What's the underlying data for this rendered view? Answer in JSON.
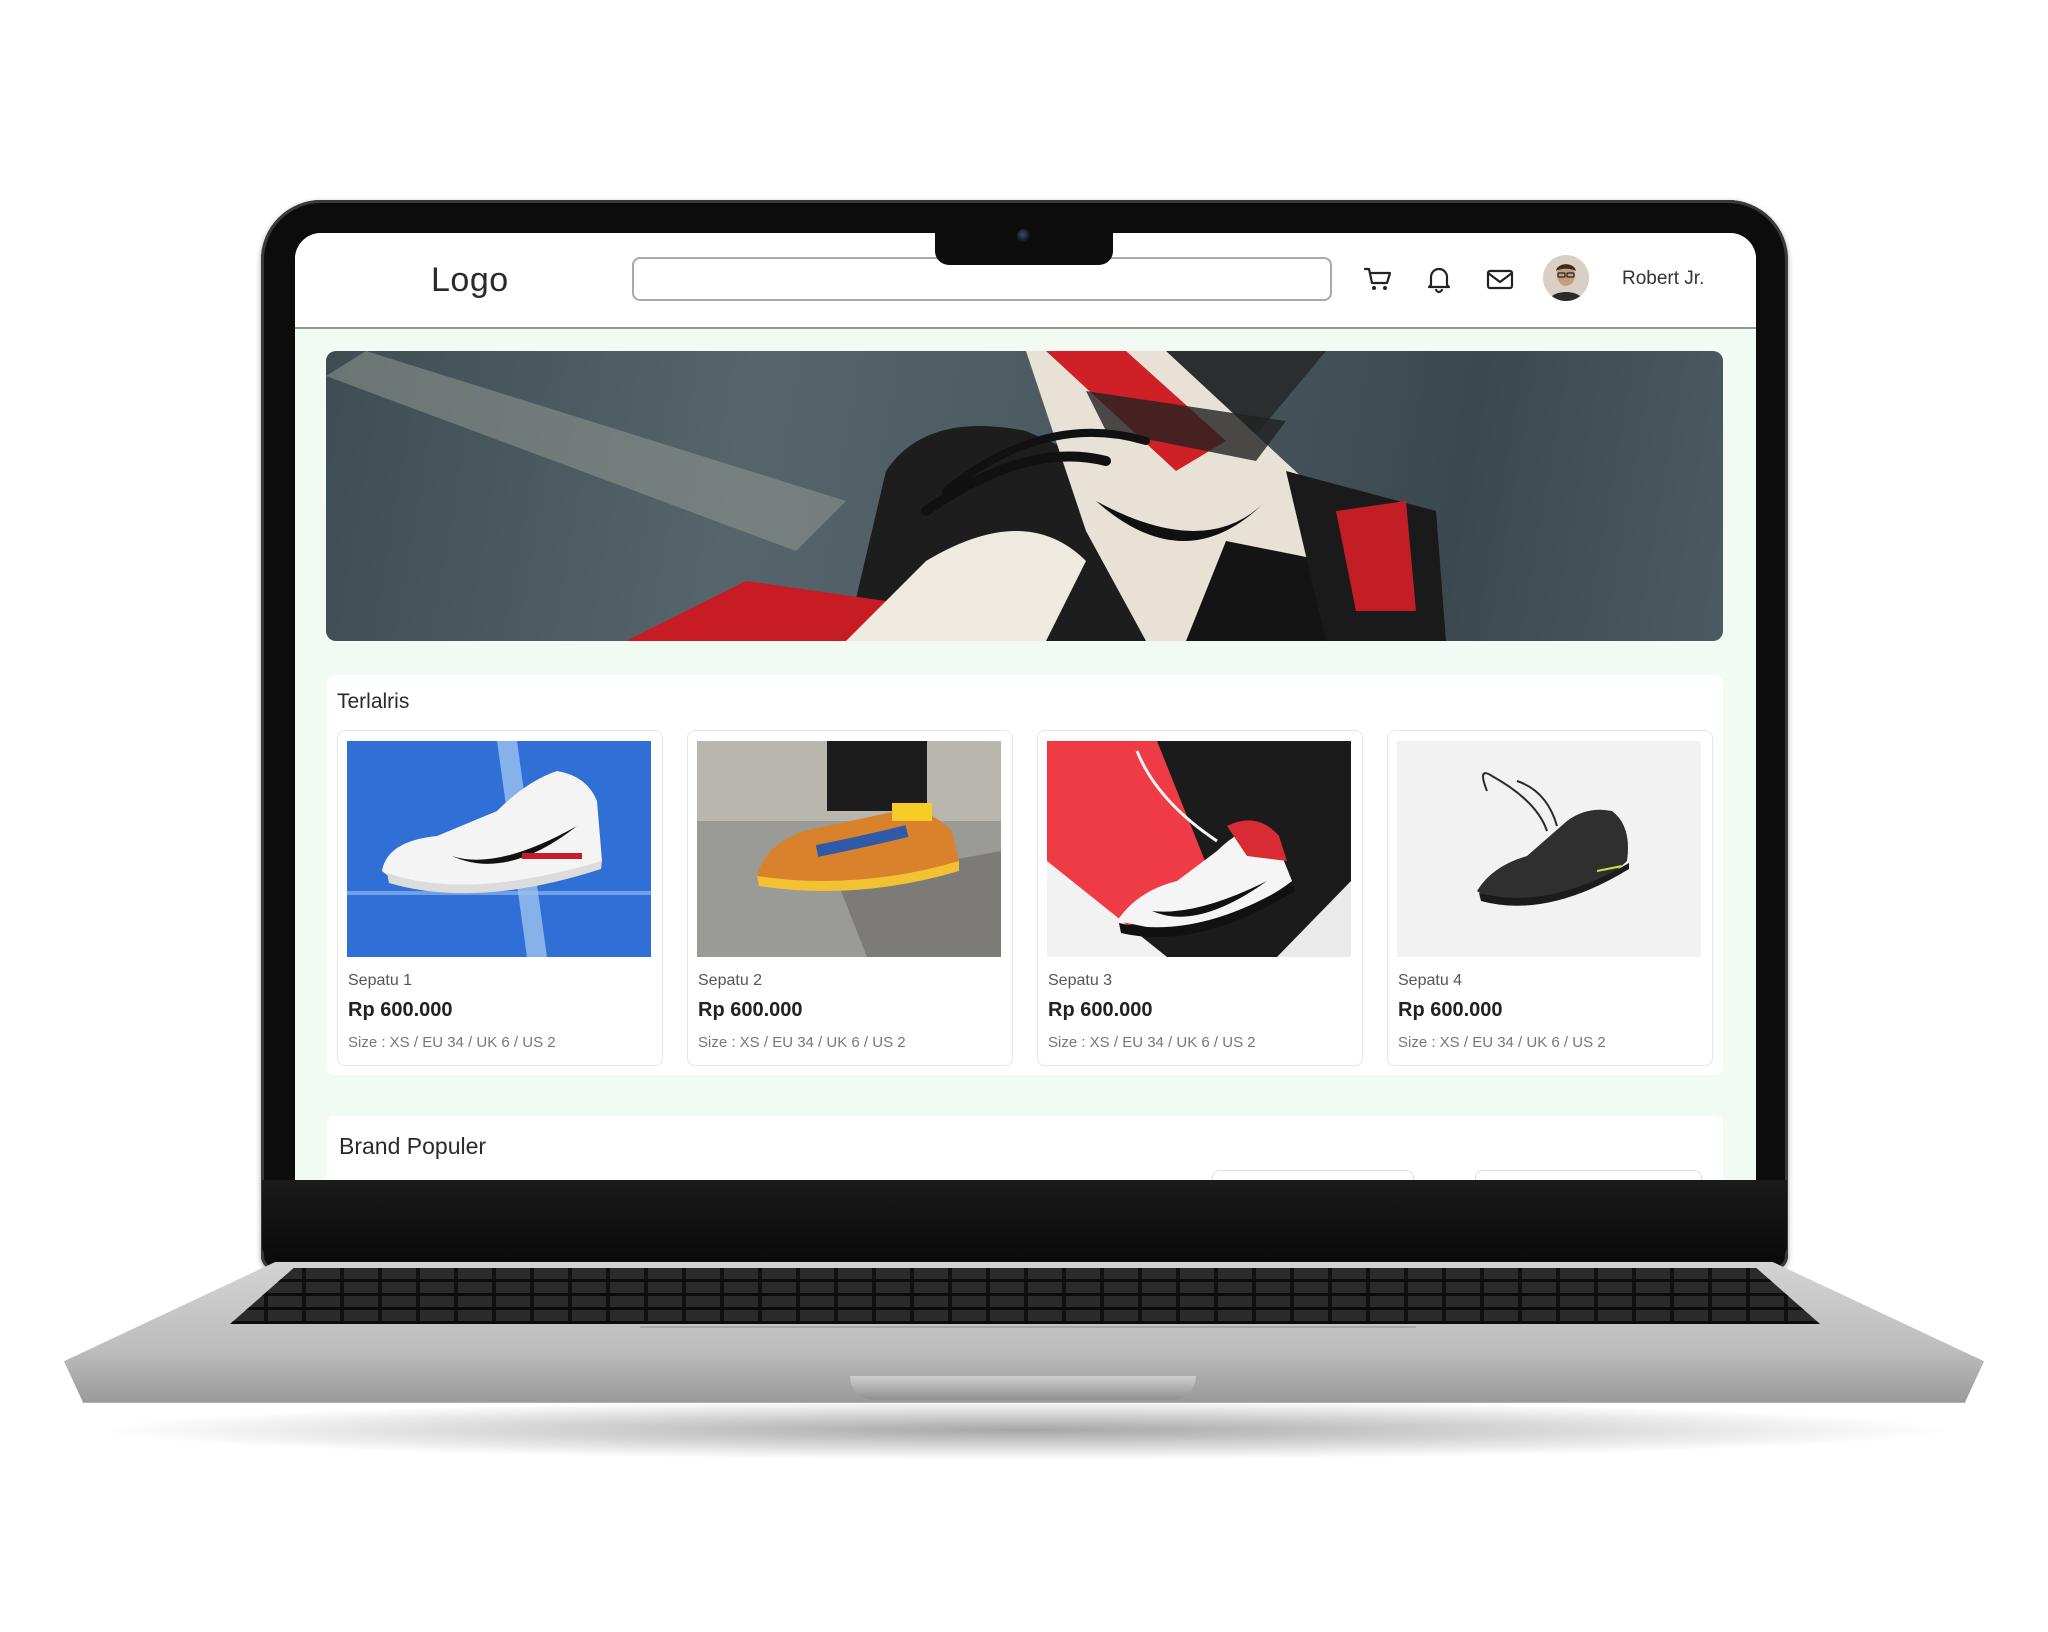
{
  "header": {
    "logo": "Logo",
    "search_placeholder": "",
    "icons": [
      "cart-icon",
      "bell-icon",
      "mail-icon"
    ],
    "user_name": "Robert Jr."
  },
  "bestsellers": {
    "title": "Terlalris",
    "items": [
      {
        "name": "Sepatu 1",
        "price": "Rp 600.000",
        "size": "Size : XS / EU 34 / UK 6 / US 2"
      },
      {
        "name": "Sepatu 2",
        "price": "Rp 600.000",
        "size": "Size : XS / EU 34 / UK 6 / US 2"
      },
      {
        "name": "Sepatu 3",
        "price": "Rp 600.000",
        "size": "Size : XS / EU 34 / UK 6 / US 2"
      },
      {
        "name": "Sepatu 4",
        "price": "Rp 600.000",
        "size": "Size : XS / EU 34 / UK 6 / US 2"
      }
    ]
  },
  "brands": {
    "title": "Brand Populer"
  },
  "colors": {
    "page_background": "#f2faf4",
    "text_dark": "#222222",
    "text_muted": "#777777"
  }
}
